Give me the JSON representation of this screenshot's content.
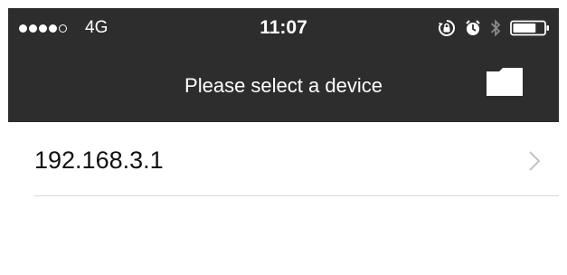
{
  "status_bar": {
    "signal_strength": 4,
    "signal_max": 5,
    "carrier": "4G",
    "time": "11:07",
    "icons": [
      "rotation-lock-icon",
      "alarm-icon",
      "bluetooth-icon",
      "battery-icon"
    ],
    "battery_level": 0.75
  },
  "nav_bar": {
    "title": "Please select a device",
    "right_button_icon": "folder-icon",
    "background_color": "#2d2d2d"
  },
  "devices": [
    {
      "label": "192.168.3.1",
      "accessory_icon": "chevron-right-icon"
    }
  ]
}
